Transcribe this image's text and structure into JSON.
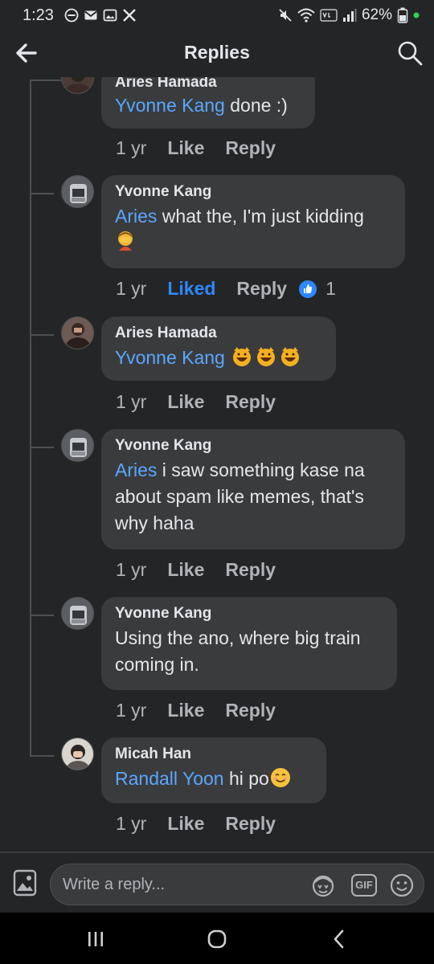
{
  "status_bar": {
    "time": "1:23",
    "battery": "62%"
  },
  "header": {
    "title": "Replies",
    "back_icon": "arrow-left-icon",
    "search_icon": "search-icon"
  },
  "comments": [
    {
      "author": "Aries Hamada",
      "mention": "Yvonne Kang",
      "text": " done :)",
      "time": "1 yr",
      "like_label": "Like",
      "reply_label": "Reply"
    },
    {
      "author": "Yvonne Kang",
      "mention": "Aries",
      "text": " what the, I'm just kidding",
      "emoji": "person-facepalming",
      "time": "1 yr",
      "like_label": "Liked",
      "reply_label": "Reply",
      "reaction": "thumbs-up",
      "reaction_count": "1"
    },
    {
      "author": "Aries Hamada",
      "mention": "Yvonne Kang",
      "text": "",
      "emoji": "grinning-cat x3",
      "time": "1 yr",
      "like_label": "Like",
      "reply_label": "Reply"
    },
    {
      "author": "Yvonne Kang",
      "mention": "Aries",
      "text": " i saw something kase na about spam like memes, that's why haha",
      "time": "1 yr",
      "like_label": "Like",
      "reply_label": "Reply"
    },
    {
      "author": "Yvonne Kang",
      "mention": "",
      "text": "Using the ano, where big train coming in.",
      "time": "1 yr",
      "like_label": "Like",
      "reply_label": "Reply"
    },
    {
      "author": "Micah Han",
      "mention": "Randall Yoon",
      "text": " hi po",
      "emoji": "smiling-face",
      "time": "1 yr",
      "like_label": "Like",
      "reply_label": "Reply"
    }
  ],
  "composer": {
    "placeholder": "Write a reply...",
    "gif_label": "GIF"
  },
  "colors": {
    "background": "#242526",
    "bubble": "#3a3b3c",
    "mention": "#5aa7ff",
    "liked": "#2d88ff",
    "meta": "#b0b3b8"
  }
}
